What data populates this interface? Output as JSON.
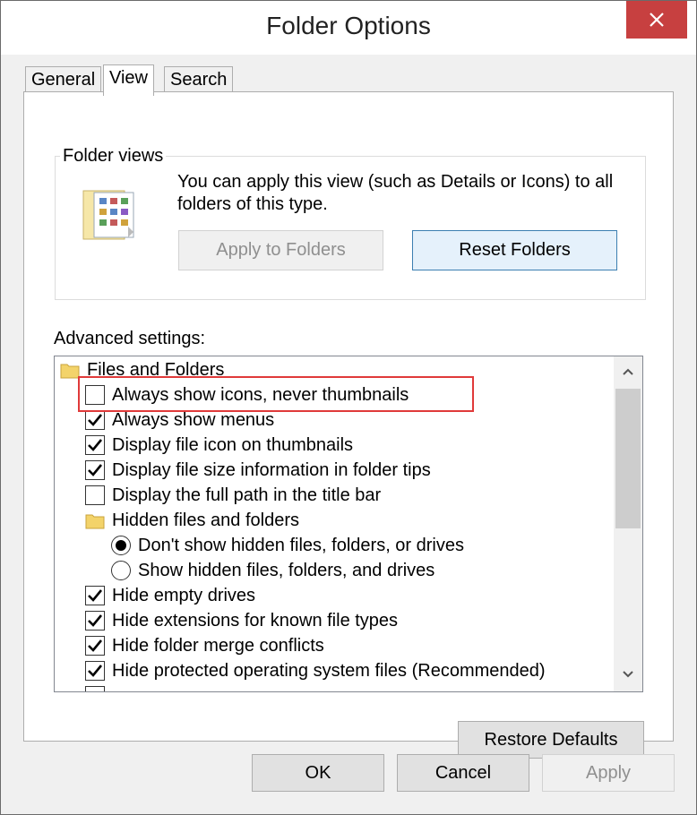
{
  "window": {
    "title": "Folder Options"
  },
  "tabs": [
    {
      "label": "General"
    },
    {
      "label": "View"
    },
    {
      "label": "Search"
    }
  ],
  "folder_views": {
    "group_label": "Folder views",
    "description": "You can apply this view (such as Details or Icons) to all folders of this type.",
    "apply_label": "Apply to Folders",
    "reset_label": "Reset Folders"
  },
  "advanced": {
    "label": "Advanced settings:",
    "items": [
      {
        "type": "folder",
        "label": "Files and Folders"
      },
      {
        "type": "checkbox",
        "label": "Always show icons, never thumbnails",
        "checked": false
      },
      {
        "type": "checkbox",
        "label": "Always show menus",
        "checked": true
      },
      {
        "type": "checkbox",
        "label": "Display file icon on thumbnails",
        "checked": true
      },
      {
        "type": "checkbox",
        "label": "Display file size information in folder tips",
        "checked": true
      },
      {
        "type": "checkbox",
        "label": "Display the full path in the title bar",
        "checked": false
      },
      {
        "type": "folder",
        "label": "Hidden files and folders"
      },
      {
        "type": "radio",
        "label": "Don't show hidden files, folders, or drives",
        "checked": true
      },
      {
        "type": "radio",
        "label": "Show hidden files, folders, and drives",
        "checked": false
      },
      {
        "type": "checkbox",
        "label": "Hide empty drives",
        "checked": true
      },
      {
        "type": "checkbox",
        "label": "Hide extensions for known file types",
        "checked": true
      },
      {
        "type": "checkbox",
        "label": "Hide folder merge conflicts",
        "checked": true
      },
      {
        "type": "checkbox",
        "label": "Hide protected operating system files (Recommended)",
        "checked": true
      }
    ],
    "restore_label": "Restore Defaults"
  },
  "footer": {
    "ok_label": "OK",
    "cancel_label": "Cancel",
    "apply_label": "Apply"
  },
  "colors": {
    "close_button": "#c74040",
    "highlight": "#e03a3a",
    "focus_border": "#3c7fb1"
  },
  "icons": [
    "close-icon",
    "folder-views-icon",
    "folder-icon",
    "checkmark-icon",
    "chevron-up-icon",
    "chevron-down-icon"
  ]
}
